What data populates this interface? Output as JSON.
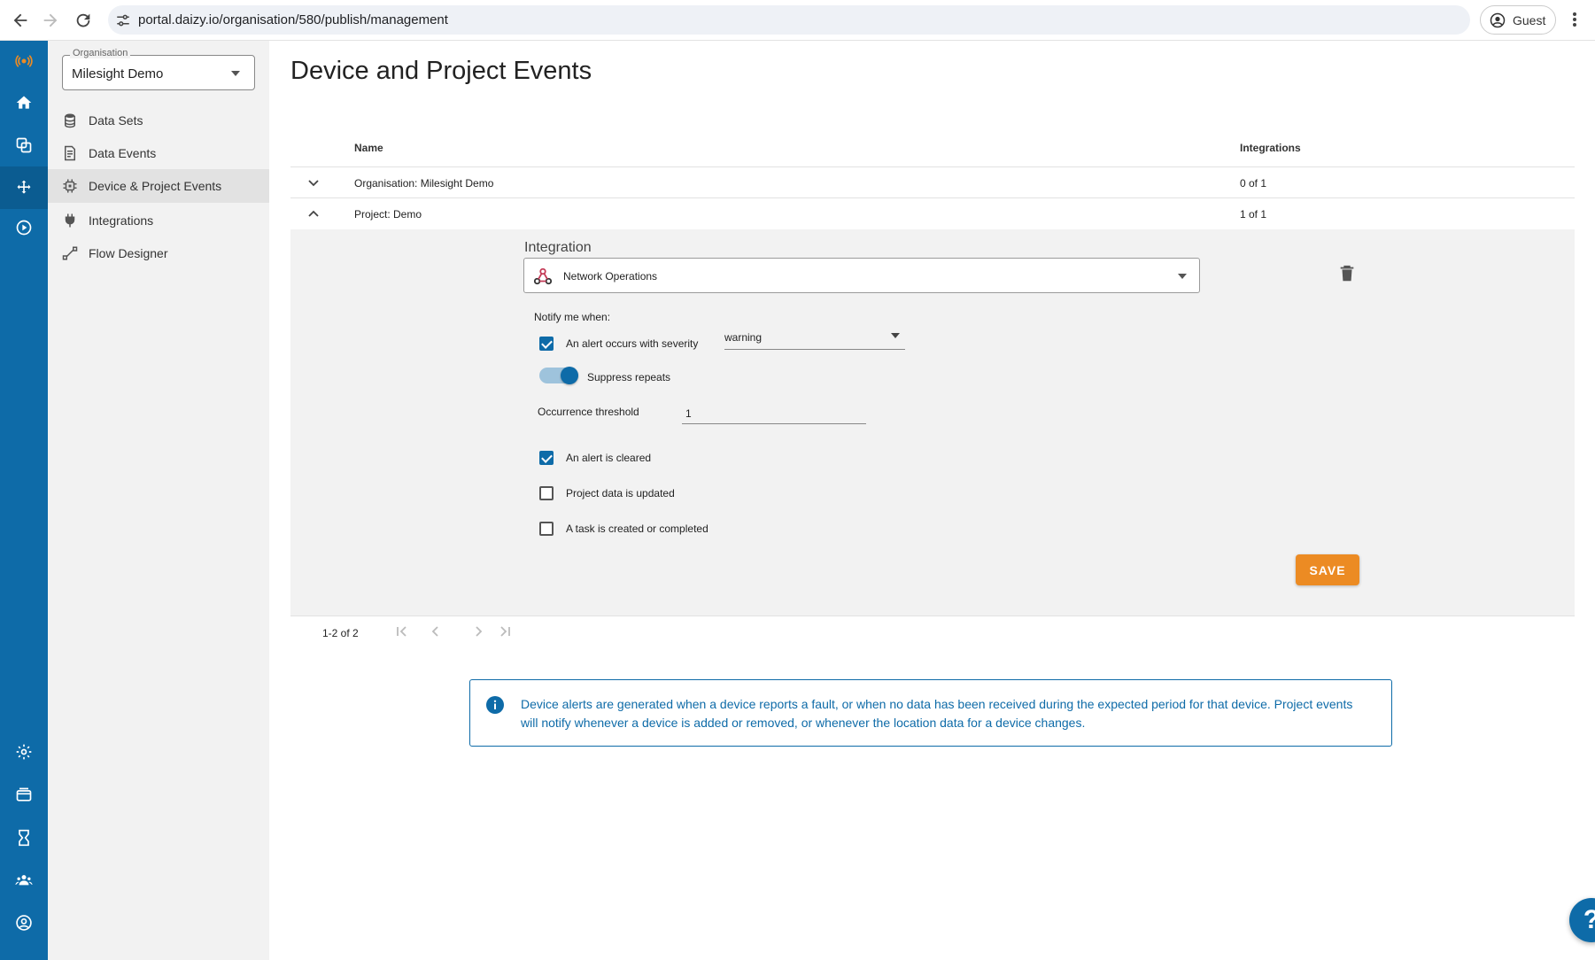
{
  "browser": {
    "url": "portal.daizy.io/organisation/580/publish/management",
    "profile_label": "Guest"
  },
  "rail": {
    "items": [
      "logo-icon",
      "home-icon",
      "devices-icon",
      "publish-icon",
      "play-icon",
      "settings-icon",
      "billing-icon",
      "hourglass-icon",
      "users-icon",
      "account-icon"
    ]
  },
  "sidebar": {
    "org_legend": "Organisation",
    "org_value": "Milesight Demo",
    "items": [
      {
        "label": "Data Sets",
        "icon": "database-icon"
      },
      {
        "label": "Data Events",
        "icon": "document-icon"
      },
      {
        "label": "Device & Project Events",
        "icon": "cpu-icon"
      },
      {
        "label": "Integrations",
        "icon": "plug-icon"
      },
      {
        "label": "Flow Designer",
        "icon": "flow-icon"
      }
    ]
  },
  "main": {
    "title": "Device and Project Events",
    "columns": {
      "name": "Name",
      "integrations": "Integrations"
    },
    "rows": [
      {
        "name": "Organisation: Milesight Demo",
        "integrations": "0 of 1"
      },
      {
        "name": "Project: Demo",
        "integrations": "1 of 1"
      }
    ],
    "detail": {
      "integration_label": "Integration",
      "integration_value": "Network Operations",
      "notify_label": "Notify me when:",
      "alert_label": "An alert occurs with severity",
      "severity_value": "warning",
      "suppress_label": "Suppress repeats",
      "threshold_label": "Occurrence threshold",
      "threshold_value": "1",
      "cleared_label": "An alert is cleared",
      "project_label": "Project data is updated",
      "task_label": "A task is created or completed",
      "save_label": "SAVE"
    },
    "pager": {
      "count": "1-2 of 2"
    },
    "info_text": "Device alerts are generated when a device reports a fault, or when no data has been received during the expected period for that device. Project events will notify whenever a device is added or removed, or whenever the location data for a device changes."
  },
  "help_label": "?",
  "colors": {
    "primary": "#0e6ba8",
    "accent": "#ec8b23",
    "sidebar_bg": "#f2f2f2"
  }
}
